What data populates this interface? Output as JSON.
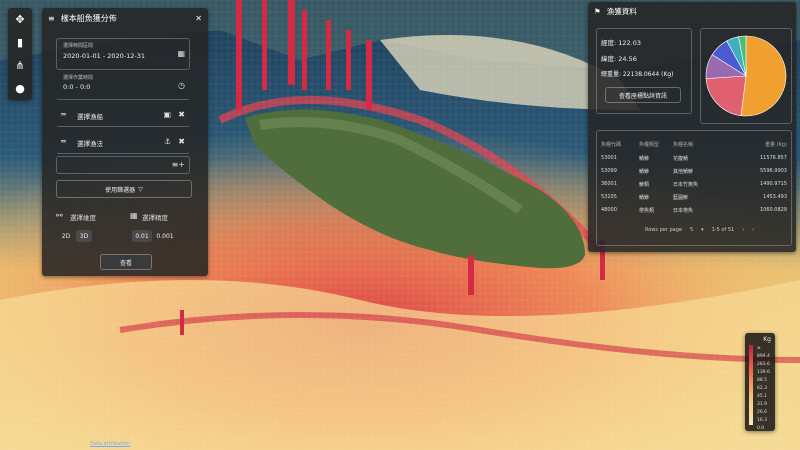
{
  "toolbar": {
    "icons": [
      "move-icon",
      "bar-chart-icon",
      "hierarchy-icon",
      "scatter-icon"
    ]
  },
  "left_panel": {
    "title": "樣本船魚獲分佈",
    "date_label": "選擇時間區間",
    "date_value": "2020-01-01 - 2020-12-31",
    "time_label": "選擇作業時間",
    "time_value": "0:0 - 0:0",
    "port_placeholder": "選擇漁船",
    "method_placeholder": "選擇漁法",
    "filter_button": "使用篩選器",
    "dim_label": "選擇維度",
    "dim_2d": "2D",
    "dim_3d": "3D",
    "res_label": "選擇精度",
    "res_1": "0.01",
    "res_2": "0.001",
    "query_button": "查看"
  },
  "right_panel": {
    "title": "漁獲資料",
    "lon": "經度: 122.03",
    "lat": "緯度: 24.56",
    "total": "總重量: 22138.0644 (Kg)",
    "detail_button": "查看座標點詳資訊",
    "columns": [
      "魚種代碼",
      "魚種類型",
      "魚種名稱",
      "重量 (Kg)"
    ],
    "rows": [
      [
        "53001",
        "鯖鰺",
        "花腹鯖",
        "11576.857"
      ],
      [
        "53099",
        "鯖鰺",
        "其他鯖鰺",
        "5596.9903"
      ],
      [
        "36001",
        "鯵類",
        "日本竹筴魚",
        "1490.9715"
      ],
      [
        "53105",
        "鯖鰺",
        "藍圓鰺",
        "1453.493"
      ],
      [
        "48000",
        "帶魚類",
        "日本帶魚",
        "1060.0829"
      ]
    ],
    "rows_per_page_label": "Rows per page",
    "rows_per_page": "5",
    "pagination": "1-5 of 51"
  },
  "pie_chart": {
    "chart_data": {
      "type": "pie",
      "values": [
        52,
        22,
        10,
        8,
        5,
        3
      ],
      "colors": [
        "#f0a030",
        "#e06070",
        "#9a6ab0",
        "#4a5ad0",
        "#40b0c0",
        "#50c070"
      ]
    }
  },
  "legend": {
    "unit": "Kg",
    "items": [
      "≥ 894.4",
      "283.6",
      "139.6",
      "88.5",
      "62.3",
      "45.1",
      "31.9",
      "26.6",
      "16.3",
      "0.0"
    ]
  },
  "attribution": "Data attribution"
}
